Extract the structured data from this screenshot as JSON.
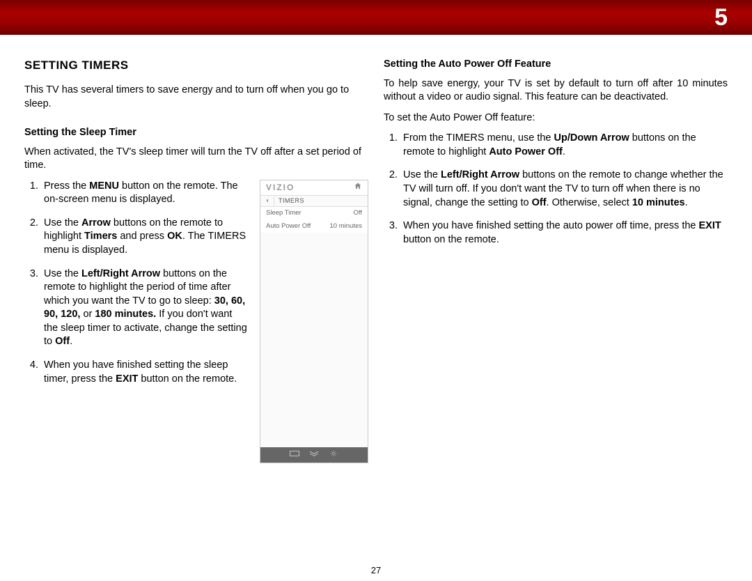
{
  "chapter_number": "5",
  "page_number": "27",
  "section_title": "Setting Timers",
  "intro": "This TV has several timers to save energy and to turn off when you go to sleep.",
  "left": {
    "subhead": "Setting the Sleep Timer",
    "lead": "When activated, the TV's sleep timer will turn the TV off after a set period of time.",
    "steps": {
      "s1a": "Press the ",
      "s1b": "MENU",
      "s1c": " button on the remote. The on-screen menu is displayed.",
      "s2a": "Use the ",
      "s2b": "Arrow",
      "s2c": " buttons on the remote to highlight ",
      "s2d": "Timers",
      "s2e": " and press ",
      "s2f": "OK",
      "s2g": ". The TIMERS menu is displayed.",
      "s3a": "Use the ",
      "s3b": "Left/Right Arrow",
      "s3c": " buttons on the remote to highlight the period of time after which you want the TV to go to sleep: ",
      "s3d": "30, 60, 90, 120,",
      "s3e": " or ",
      "s3f": "180 minutes.",
      "s3g": " If you don't want the sleep timer to activate, change the setting to ",
      "s3h": "Off",
      "s3i": ".",
      "s4a": "When you have finished setting the sleep timer, press the ",
      "s4b": "EXIT",
      "s4c": " button on the remote."
    }
  },
  "right": {
    "subhead": "Setting the Auto Power Off Feature",
    "lead": "To help save energy, your TV is set by default to turn off after 10 minutes without a video or audio signal. This feature can be deactivated.",
    "leadin": "To set the Auto Power Off feature:",
    "steps": {
      "s1a": "From the TIMERS menu, use the ",
      "s1b": "Up/Down Arrow",
      "s1c": " buttons on the remote to highlight ",
      "s1d": "Auto Power Off",
      "s1e": ".",
      "s2a": "Use the ",
      "s2b": "Left/Right Arrow",
      "s2c": " buttons on the remote to change whether the TV will turn off. If you don't want the TV to turn off when there is no signal, change the setting to ",
      "s2d": "Off",
      "s2e": ". Otherwise, select ",
      "s2f": "10 minutes",
      "s2g": ".",
      "s3a": "When you have finished setting the auto power off time, press the ",
      "s3b": "EXIT",
      "s3c": " button on the remote."
    }
  },
  "screen": {
    "brand": "VIZIO",
    "crumb": "TIMERS",
    "rows": [
      {
        "label": "Sleep Timer",
        "value": "Off"
      },
      {
        "label": "Auto Power Off",
        "value": "10 minutes"
      }
    ]
  }
}
